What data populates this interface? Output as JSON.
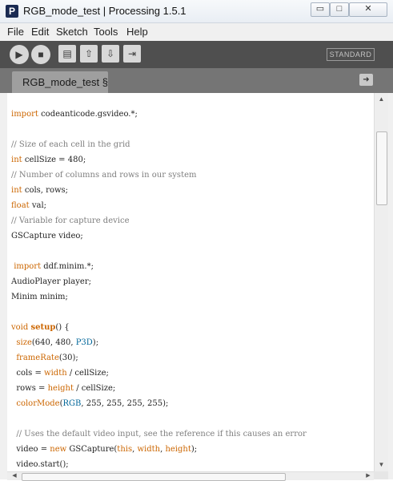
{
  "window": {
    "title": "RGB_mode_test | Processing 1.5.1",
    "app_icon_letter": "P",
    "minimize_glyph": "▭",
    "maximize_glyph": "□",
    "close_glyph": "✕"
  },
  "menu": {
    "items": [
      "File",
      "Edit",
      "Sketch",
      "Tools",
      "Help"
    ]
  },
  "toolbar": {
    "run_icon": "run-icon",
    "stop_icon": "stop-icon",
    "new_icon": "new-icon",
    "open_icon": "open-icon",
    "save_icon": "save-icon",
    "export_icon": "export-icon",
    "mode_label": "STANDARD"
  },
  "tabs": {
    "active_label": "RGB_mode_test §",
    "menu_arrow": "➜"
  },
  "code": {
    "lines": [
      "import codeanticode.gsvideo.*;",
      "",
      "// Size of each cell in the grid",
      "int cellSize = 480;",
      "// Number of columns and rows in our system",
      "int cols, rows;",
      "float val;",
      "// Variable for capture device",
      "GSCapture video;",
      "",
      " import ddf.minim.*;",
      "AudioPlayer player;",
      "Minim minim;",
      "",
      "void setup() {",
      "  size(640, 480, P3D);",
      "  frameRate(30);",
      "  cols = width / cellSize;",
      "  rows = height / cellSize;",
      "  colorMode(RGB, 255, 255, 255, 255);",
      "",
      "  // Uses the default video input, see the reference if this causes an error",
      "  video = new GSCapture(this, width, height);",
      "  video.start();"
    ]
  },
  "colors": {
    "keyword": "#cc6600",
    "comment": "#7e7e7e",
    "constant": "#006699",
    "toolbar_bg": "#4f4f4f",
    "tabstrip_bg": "#757575"
  }
}
